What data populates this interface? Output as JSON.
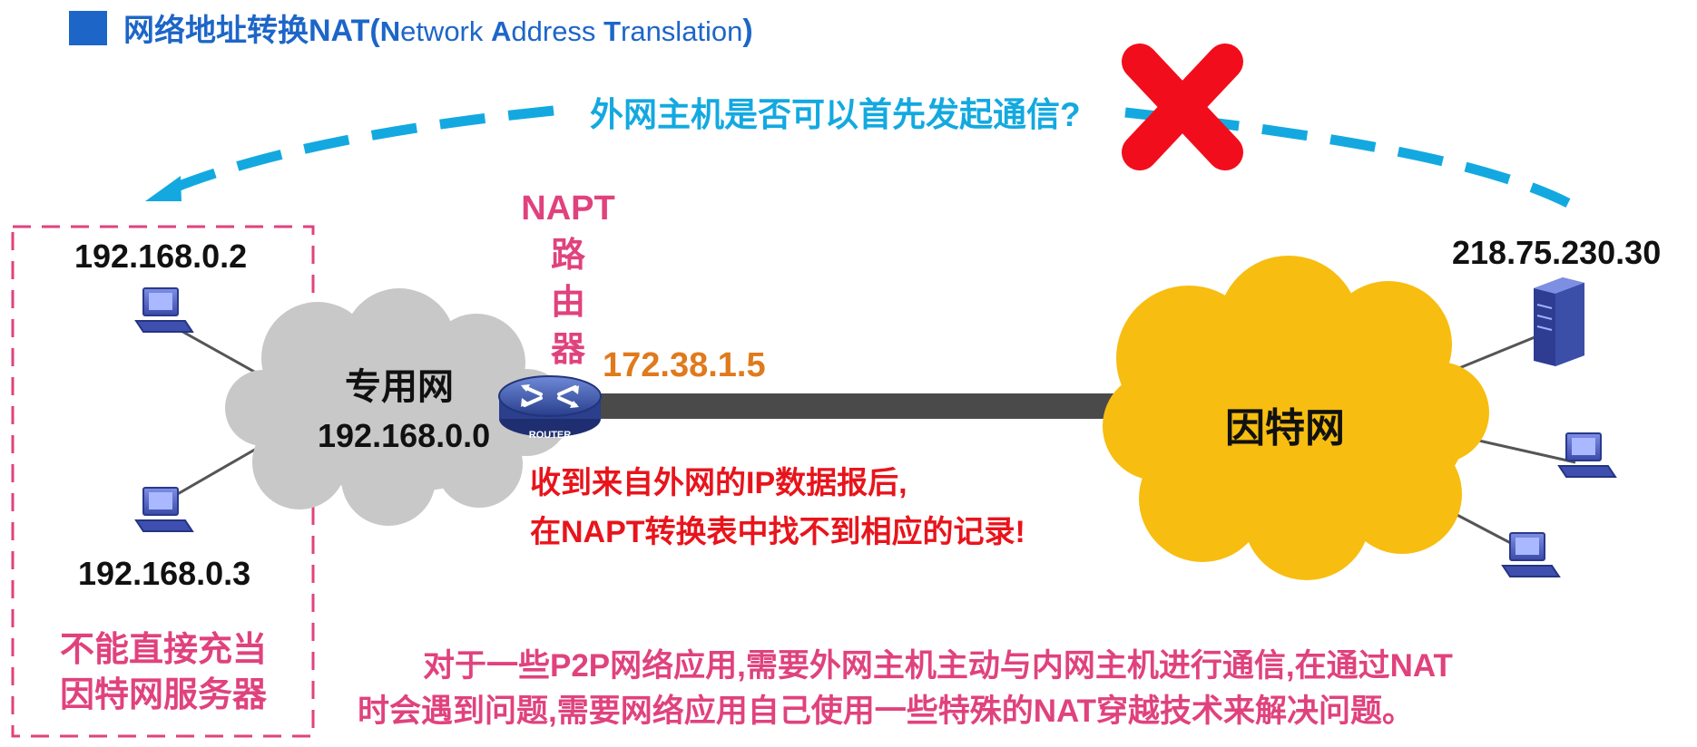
{
  "title": {
    "zh": "网络地址转换NAT(",
    "en_parts": [
      {
        "text": "N",
        "bold": true
      },
      {
        "text": "etwork ",
        "bold": false
      },
      {
        "text": "A",
        "bold": true
      },
      {
        "text": "ddress ",
        "bold": false
      },
      {
        "text": "T",
        "bold": true
      },
      {
        "text": "ranslation",
        "bold": false
      }
    ],
    "close": ")"
  },
  "question": "外网主机是否可以首先发起通信?",
  "private_hosts": [
    "192.168.0.2",
    "192.168.0.3"
  ],
  "private_net": {
    "name": "专用网",
    "address": "192.168.0.0"
  },
  "router": {
    "label_lines": [
      "NAPT",
      "路",
      "由",
      "器"
    ],
    "icon_text": "ROUTER",
    "public_ip": "172.38.1.5"
  },
  "internet": {
    "name": "因特网"
  },
  "server_ip": "218.75.230.30",
  "error_msg": [
    "收到来自外网的IP数据报后,",
    "在NAPT转换表中找不到相应的记录!"
  ],
  "private_note": [
    "不能直接充当",
    "因特网服务器"
  ],
  "bottom_note": [
    "对于一些P2P网络应用,需要外网主机主动与内网主机进行通信,在通过NAT",
    "时会遇到问题,需要网络应用自己使用一些特殊的NAT穿越技术来解决问题。"
  ],
  "colors": {
    "title_blue": "#1d66c8",
    "question_blue": "#13a9e0",
    "napt_pink": "#e0427d",
    "ip_orange": "#e07a1c",
    "error_red": "#e8141c",
    "cloud_gray": "#c8c8c8",
    "cloud_yellow": "#f7bd10",
    "cross_red": "#f20d1c"
  }
}
